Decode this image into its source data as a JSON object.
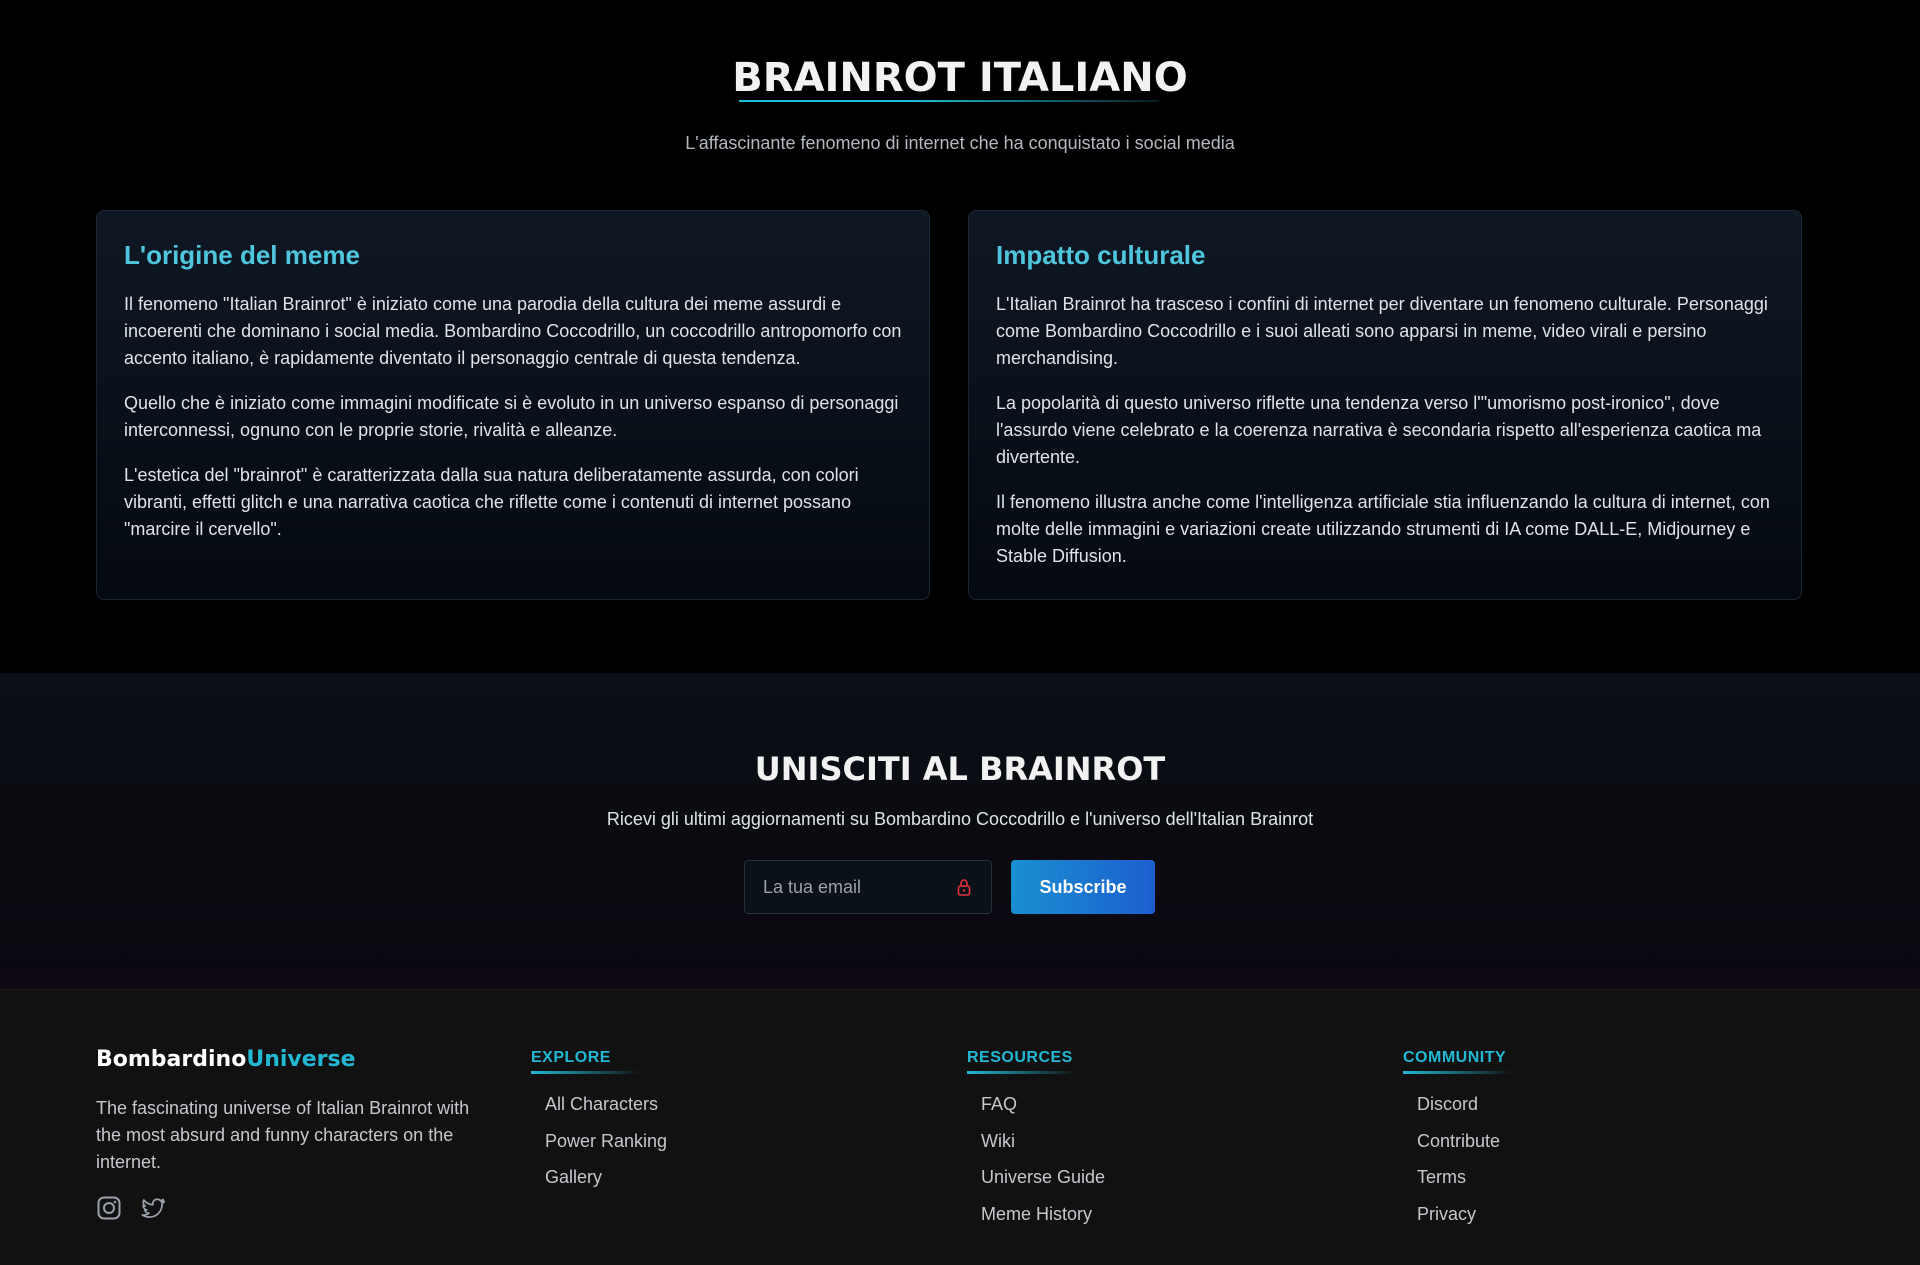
{
  "hero": {
    "title": "BRAINROT ITALIANO",
    "subtitle": "L'affascinante fenomeno di internet che ha conquistato i social media"
  },
  "cards": {
    "origin": {
      "title": "L'origine del meme",
      "paragraphs": [
        "Il fenomeno \"Italian Brainrot\" è iniziato come una parodia della cultura dei meme assurdi e incoerenti che dominano i social media. Bombardino Coccodrillo, un coccodrillo antropomorfo con accento italiano, è rapidamente diventato il personaggio centrale di questa tendenza.",
        "Quello che è iniziato come immagini modificate si è evoluto in un universo espanso di personaggi interconnessi, ognuno con le proprie storie, rivalità e alleanze.",
        "L'estetica del \"brainrot\" è caratterizzata dalla sua natura deliberatamente assurda, con colori vibranti, effetti glitch e una narrativa caotica che riflette come i contenuti di internet possano \"marcire il cervello\"."
      ]
    },
    "impact": {
      "title": "Impatto culturale",
      "paragraphs": [
        "L'Italian Brainrot ha trasceso i confini di internet per diventare un fenomeno culturale. Personaggi come Bombardino Coccodrillo e i suoi alleati sono apparsi in meme, video virali e persino merchandising.",
        "La popolarità di questo universo riflette una tendenza verso l'\"umorismo post-ironico\", dove l'assurdo viene celebrato e la coerenza narrativa è secondaria rispetto all'esperienza caotica ma divertente.",
        "Il fenomeno illustra anche come l'intelligenza artificiale stia influenzando la cultura di internet, con molte delle immagini e variazioni create utilizzando strumenti di IA come DALL-E, Midjourney e Stable Diffusion."
      ]
    }
  },
  "newsletter": {
    "title": "UNISCITI AL BRAINROT",
    "text": "Ricevi gli ultimi aggiornamenti su Bombardino Coccodrillo e l'universo dell'Italian Brainrot",
    "email_placeholder": "La tua email",
    "email_value": "",
    "lock_icon": "lock-icon",
    "subscribe_label": "Subscribe"
  },
  "footer": {
    "brand_main": "Bombardino",
    "brand_accent": "Universe",
    "description": "The fascinating universe of Italian Brainrot with the most absurd and funny characters on the internet.",
    "social": [
      "instagram-icon",
      "twitter-icon"
    ],
    "columns": {
      "explore": {
        "heading": "EXPLORE",
        "links": [
          "All Characters",
          "Power Ranking",
          "Gallery"
        ]
      },
      "resources": {
        "heading": "RESOURCES",
        "links": [
          "FAQ",
          "Wiki",
          "Universe Guide",
          "Meme History"
        ]
      },
      "community": {
        "heading": "COMMUNITY",
        "links": [
          "Discord",
          "Contribute",
          "Terms",
          "Privacy"
        ]
      }
    }
  },
  "colors": {
    "accent": "#22b8d4",
    "card_title": "#4fc6dd",
    "button": "#1a8fd0",
    "lock_icon": "#e0303a"
  }
}
